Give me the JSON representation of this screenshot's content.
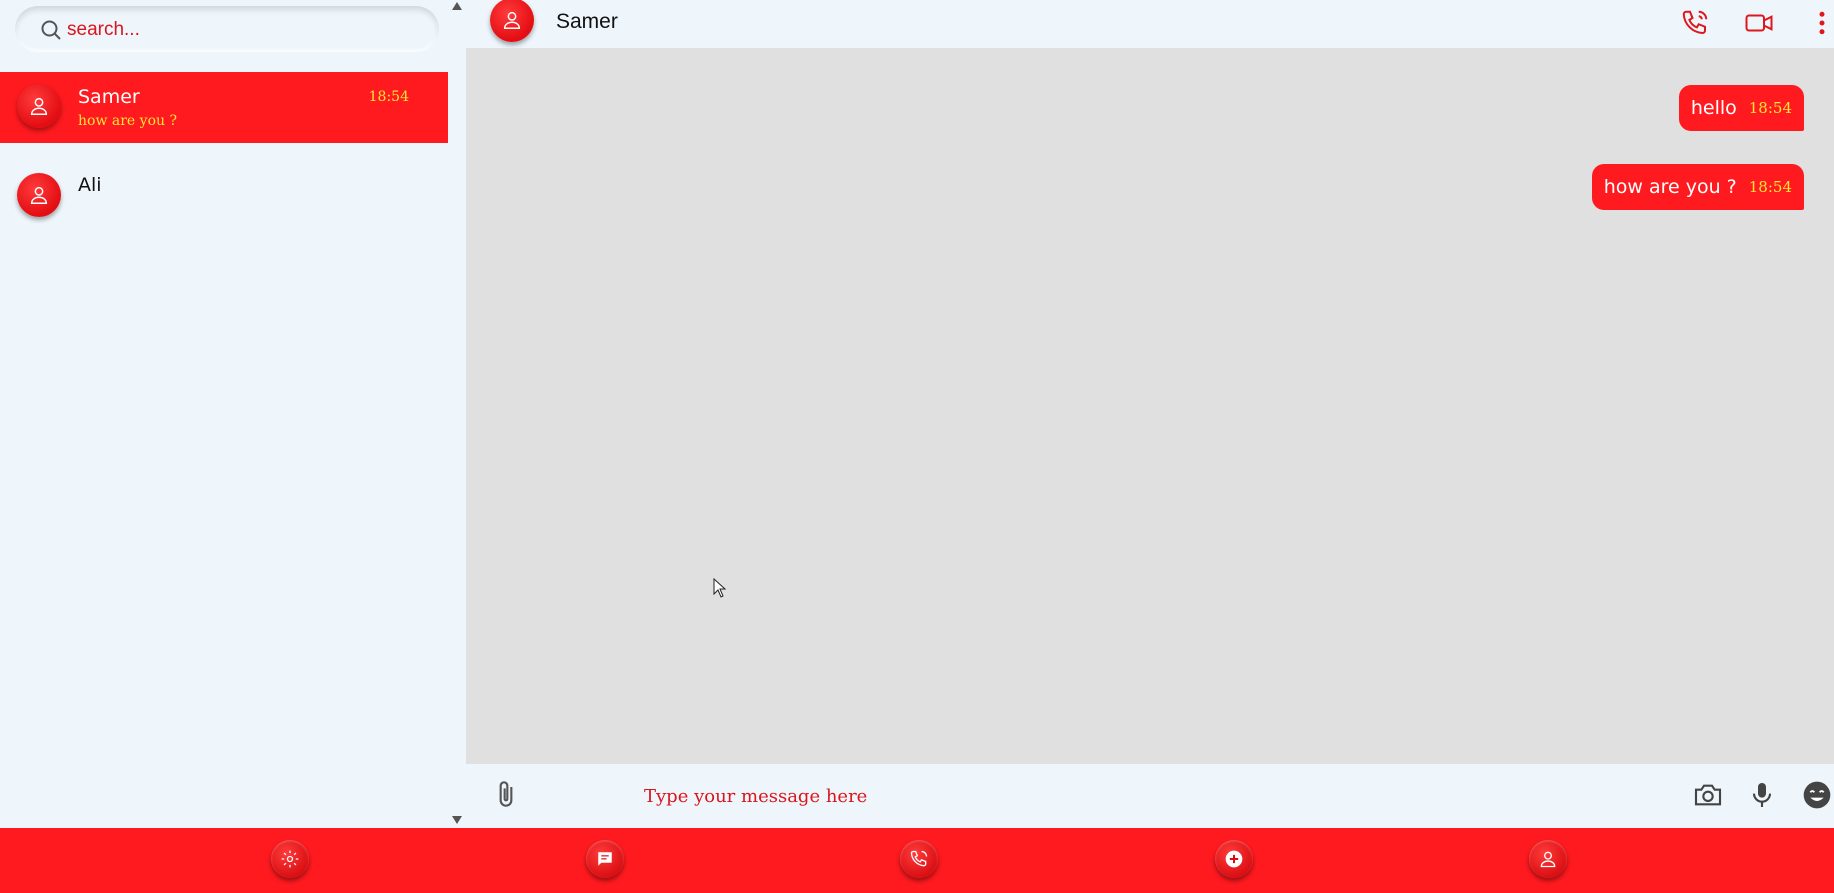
{
  "colors": {
    "accent": "#ff1a1f",
    "accent_text": "#ffe43a",
    "panel_bg": "#eef6fc",
    "messages_bg": "#e0e0e0"
  },
  "search": {
    "placeholder": "search..."
  },
  "chats": [
    {
      "name": "Samer",
      "time": "18:54",
      "preview": "how are you ?",
      "active": true
    },
    {
      "name": "Ali",
      "time": "",
      "preview": "",
      "active": false
    }
  ],
  "header": {
    "name": "Samer",
    "icons": [
      "phone-icon",
      "video-icon",
      "more-vertical-icon"
    ]
  },
  "messages": [
    {
      "text": "hello",
      "time": "18:54"
    },
    {
      "text": "how are you ?",
      "time": "18:54"
    }
  ],
  "composer": {
    "placeholder": "Type your message here",
    "icons": [
      "attach-icon",
      "camera-icon",
      "mic-icon",
      "emoji-icon"
    ]
  },
  "bottom_nav": {
    "items": [
      "settings-icon",
      "chat-icon",
      "calls-icon",
      "add-icon",
      "profile-icon"
    ]
  }
}
